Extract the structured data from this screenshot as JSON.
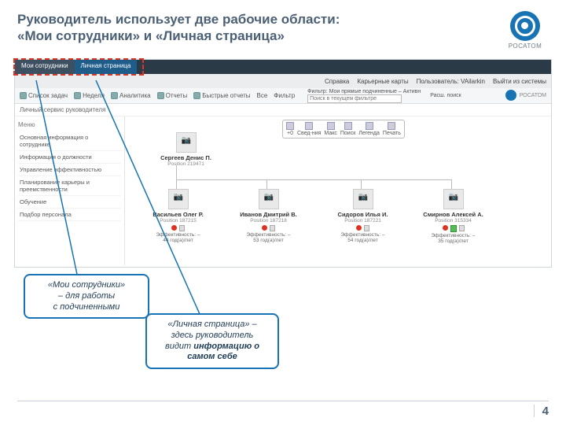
{
  "slide": {
    "title_l1": "Руководитель использует две рабочие области:",
    "title_l2": "«Мои сотрудники» и «Личная страница»",
    "logo_text": "РОСАТОМ",
    "page_number": "4"
  },
  "tabs": {
    "my_staff": "Мои сотрудники",
    "personal": "Личная страница"
  },
  "topright": {
    "help": "Справка",
    "career": "Карьерные карты",
    "user_label": "Пользователь: VAilarkin",
    "logout": "Выйти из системы"
  },
  "toolbar": {
    "tasks": "Список задач",
    "week": "Неделя",
    "analytics": "Аналитика",
    "reports": "Отчеты",
    "quick": "Быстрые отчеты",
    "all": "Все",
    "filter": "Фильтр",
    "filter_label": "Фильтр: Мои прямые подчиненные – Активн",
    "search_placeholder": "Поиск в текущем фильтре",
    "ext_search": "Расш. поиск",
    "mini_logo": "РОСАТОМ"
  },
  "subtitle": "Личный сервис руководителя",
  "sidebar": {
    "header": "Меню",
    "items": [
      "Основная информация о сотруднике",
      "Информация о должности",
      "Управление эффективностью",
      "Планирование карьеры и преемственности",
      "Обучение",
      "Подбор персонала"
    ]
  },
  "controls": {
    "items": [
      "+0",
      "Свед-ния",
      "Макс",
      "Поиск",
      "Легенда",
      "Печать"
    ]
  },
  "org": {
    "root": {
      "name": "Сергеев Денис П.",
      "pos": "Position 219471"
    },
    "children": [
      {
        "name": "Васильев Олег Р.",
        "pos": "Position 187215",
        "eff": "Эффективность: –",
        "age": "44 год(а)/лет",
        "green": false
      },
      {
        "name": "Иванов Дмитрий В.",
        "pos": "Position 187218",
        "eff": "Эффективность: –",
        "age": "53 год(а)/лет",
        "green": false
      },
      {
        "name": "Сидоров Илья И.",
        "pos": "Position 187221",
        "eff": "Эффективность: –",
        "age": "54 год(а)/лет",
        "green": false
      },
      {
        "name": "Смирнов Алексей А.",
        "pos": "Position 315334",
        "eff": "Эффективность: –",
        "age": "35 год(а)/лет",
        "green": true
      }
    ]
  },
  "callouts": {
    "c1_l1": "«Мои сотрудники»",
    "c1_l2": "– для работы",
    "c1_l3": "с подчиненными",
    "c2_l1": "«Личная страница» –",
    "c2_l2": "здесь руководитель",
    "c2_l3": "видит ",
    "c2_b1": "информацию о самом себе"
  }
}
